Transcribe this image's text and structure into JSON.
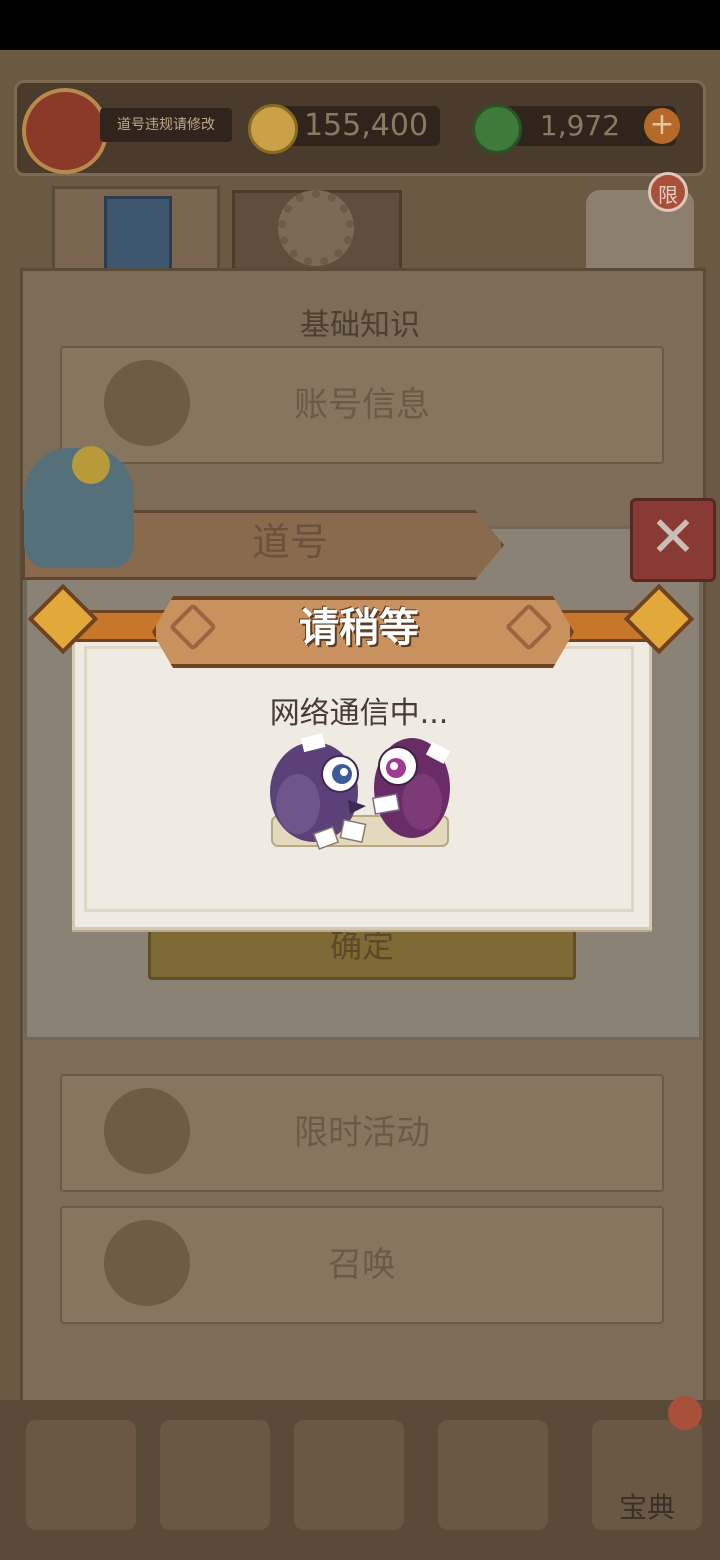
{
  "player": {
    "name": "道号违规请修改",
    "coins": "155,400",
    "gems": "1,972",
    "add_symbol": "+"
  },
  "tabs": {
    "badge": "限"
  },
  "panel": {
    "section_title": "基础知识",
    "items": [
      {
        "label": "账号信息",
        "icon": "snake-icon"
      },
      {
        "label": "限时活动",
        "icon": "hourglass-icon"
      },
      {
        "label": "召唤",
        "icon": "drum-icon"
      }
    ]
  },
  "nav": {
    "codex_label": "宝典"
  },
  "dialog": {
    "title": "道号",
    "confirm_label": "确定",
    "close_symbol": "✕"
  },
  "modal": {
    "title": "请稍等",
    "message": "网络通信中..."
  },
  "colors": {
    "accent": "#c8772a",
    "title_plate": "#c8915e",
    "modal_bg": "#f0ebe2"
  }
}
